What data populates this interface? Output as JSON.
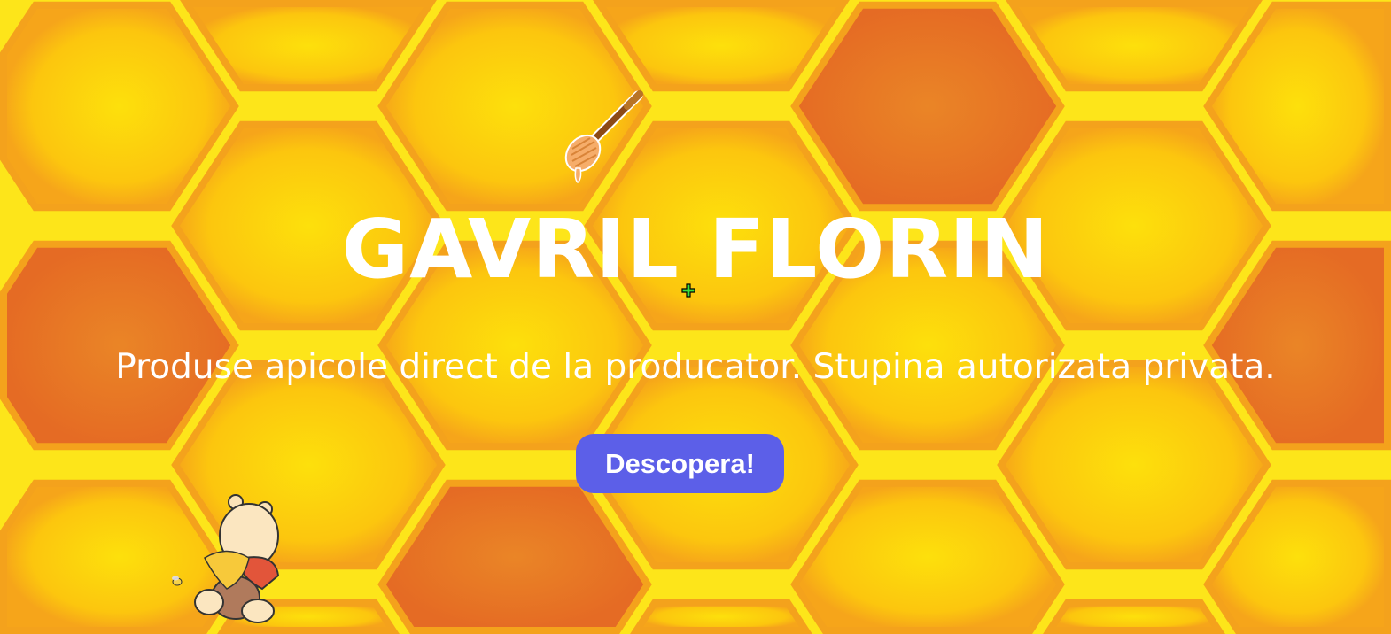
{
  "hero": {
    "title": "GAVRIL FLORIN",
    "subtitle": "Produse apicole direct de la producator. Stupina autorizata privata.",
    "cta_label": "Descopera!"
  },
  "colors": {
    "honey_yellow": "#fde00c",
    "honey_orange": "#e56b24",
    "button": "#5c5fe8",
    "text": "#ffffff"
  },
  "icons": [
    "honey-dipper-icon",
    "winnie-the-pooh-illustration",
    "crosshair-cursor-icon"
  ]
}
